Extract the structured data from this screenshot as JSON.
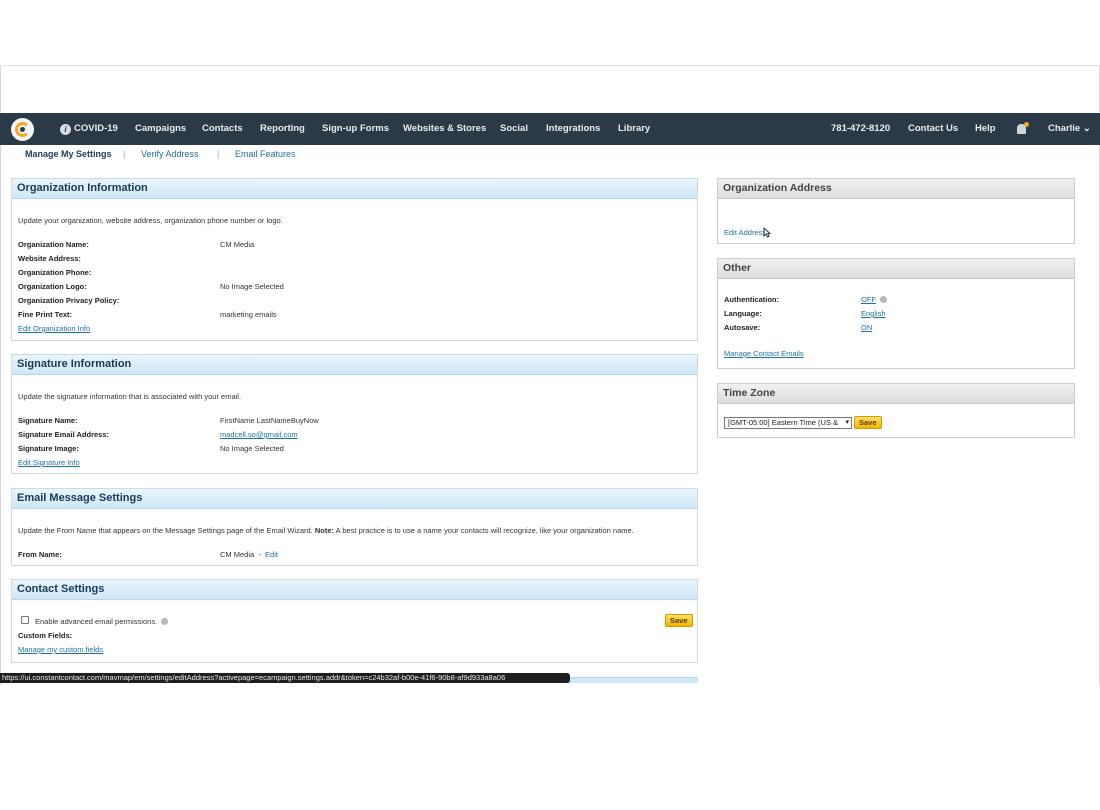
{
  "nav": {
    "items": [
      "COVID-19",
      "Campaigns",
      "Contacts",
      "Reporting",
      "Sign-up Forms",
      "Websites & Stores",
      "Social",
      "Integrations",
      "Library"
    ],
    "phone": "781-472-8120",
    "contact_us": "Contact Us",
    "help": "Help",
    "user": "Charlie",
    "user_caret": "⌄",
    "info_glyph": "i"
  },
  "subtabs": {
    "manage": "Manage My Settings",
    "verify": "Verify Address",
    "email_features": "Email Features",
    "separator": "|"
  },
  "org_info": {
    "title": "Organization Information",
    "description": "Update your organization, website address, organization phone number or logo.",
    "labels": [
      "Organization Name:",
      "Website Address:",
      "Organization Phone:",
      "Organization Logo:",
      "Organization Privacy Policy:",
      "Fine Print Text:"
    ],
    "values": [
      "CM Media",
      "",
      "",
      "No Image Selected",
      "",
      "marketing emails"
    ],
    "edit_link": "Edit Organization Info"
  },
  "signature": {
    "title": "Signature Information",
    "description": "Update the signature information that is associated with your email.",
    "labels": [
      "Signature Name:",
      "Signature Email Address:",
      "Signature Image:"
    ],
    "name_value": "FirstName LastNameBuyNow",
    "email_value": "madcell.so@gmail.com",
    "image_value": "No Image Selected",
    "edit_link": "Edit Signature Info"
  },
  "email_msg": {
    "title": "Email Message Settings",
    "description_pre": "Update the From Name that appears on the Message Settings page of the Email Wizard. ",
    "note_label": "Note:",
    "description_post": " A best practice is to use a name your contacts will recognize, like your organization name.",
    "from_label": "From Name:",
    "from_value": "CM Media",
    "dash": "-",
    "edit_link": "Edit"
  },
  "contact_settings": {
    "title": "Contact Settings",
    "checkbox_label": "Enable advanced email permissions.",
    "custom_fields_label": "Custom Fields:",
    "manage_link": "Manage my custom fields",
    "save": "Save"
  },
  "org_address": {
    "title": "Organization Address",
    "edit_link": "Edit Address"
  },
  "other": {
    "title": "Other",
    "labels": [
      "Authentication:",
      "Language:",
      "Autosave:"
    ],
    "values": [
      "OFF",
      "English",
      "ON"
    ],
    "manage_link": "Manage Contact Emails"
  },
  "timezone": {
    "title": "Time Zone",
    "selected": "[GMT-05:00] Eastern Time (US &",
    "save": "Save"
  },
  "status_url": "https://ui.constantcontact.com/mavmap/em/settings/editAddress?activepage=ecampaign.settings.addr&token=c24b32af-b00e-41f6-90b8-af9d933a8a06",
  "colors": {
    "nav_bg": "#2b3a46",
    "accent": "#f6a623",
    "link": "#1f6fa8",
    "panel_header": "#cde8f7"
  }
}
